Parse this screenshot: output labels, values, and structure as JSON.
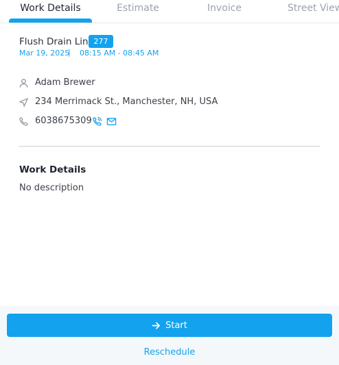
{
  "tabs": [
    {
      "label": "Work Details",
      "active": true
    },
    {
      "label": "Estimate",
      "active": false
    },
    {
      "label": "Invoice",
      "active": false
    },
    {
      "label": "Street View",
      "active": false
    }
  ],
  "job": {
    "title": "Flush Drain Line",
    "badge": "277",
    "date": "Mar 19, 2025",
    "separator": "|",
    "time_range": "08:15 AM - 08:45 AM"
  },
  "customer": {
    "name": "Adam Brewer",
    "address": "234 Merrimack St., Manchester, NH, USA",
    "phone": "6038675309"
  },
  "work_details": {
    "title": "Work Details",
    "description": "No description"
  },
  "actions": {
    "start_label": "Start",
    "reschedule_label": "Reschedule"
  },
  "colors": {
    "accent": "#13a2ee",
    "text": "#2b2f38",
    "muted": "#9aa1ad",
    "bottom_bar": "#f5f8fb"
  },
  "icons": {
    "name": "user-icon",
    "address": "navigation-arrow-icon",
    "phone": "phone-icon",
    "call": "phone-call-icon",
    "email": "email-icon",
    "start": "arrow-right-icon"
  }
}
